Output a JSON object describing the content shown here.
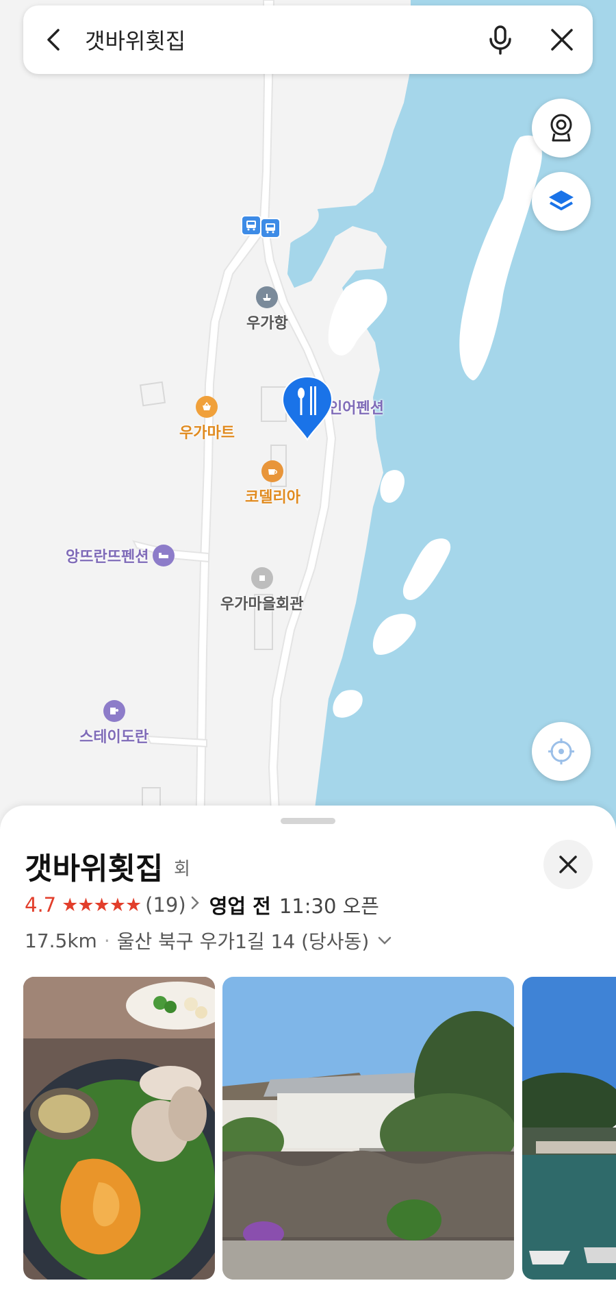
{
  "search": {
    "query": "갯바위횟집"
  },
  "map": {
    "pois": {
      "harbor": "우가항",
      "mart": "우가마트",
      "cafe": "코델리아",
      "pension1": "앙뜨란뜨펜션",
      "hall": "우가마을회관",
      "stay": "스테이도란",
      "pension2": "인어펜션"
    },
    "colors": {
      "sea": "#a5d6ea",
      "land": "#f3f3f3",
      "road": "#ffffff",
      "pin": "#1a73e8"
    }
  },
  "place": {
    "name": "갯바위횟집",
    "category": "회",
    "rating": "4.7",
    "stars": "★★★★★",
    "review_count": "(19)",
    "status": "영업 전",
    "hours": "11:30 오픈",
    "distance": "17.5km",
    "address": "울산 북구 우가1길 14 (당사동)"
  }
}
